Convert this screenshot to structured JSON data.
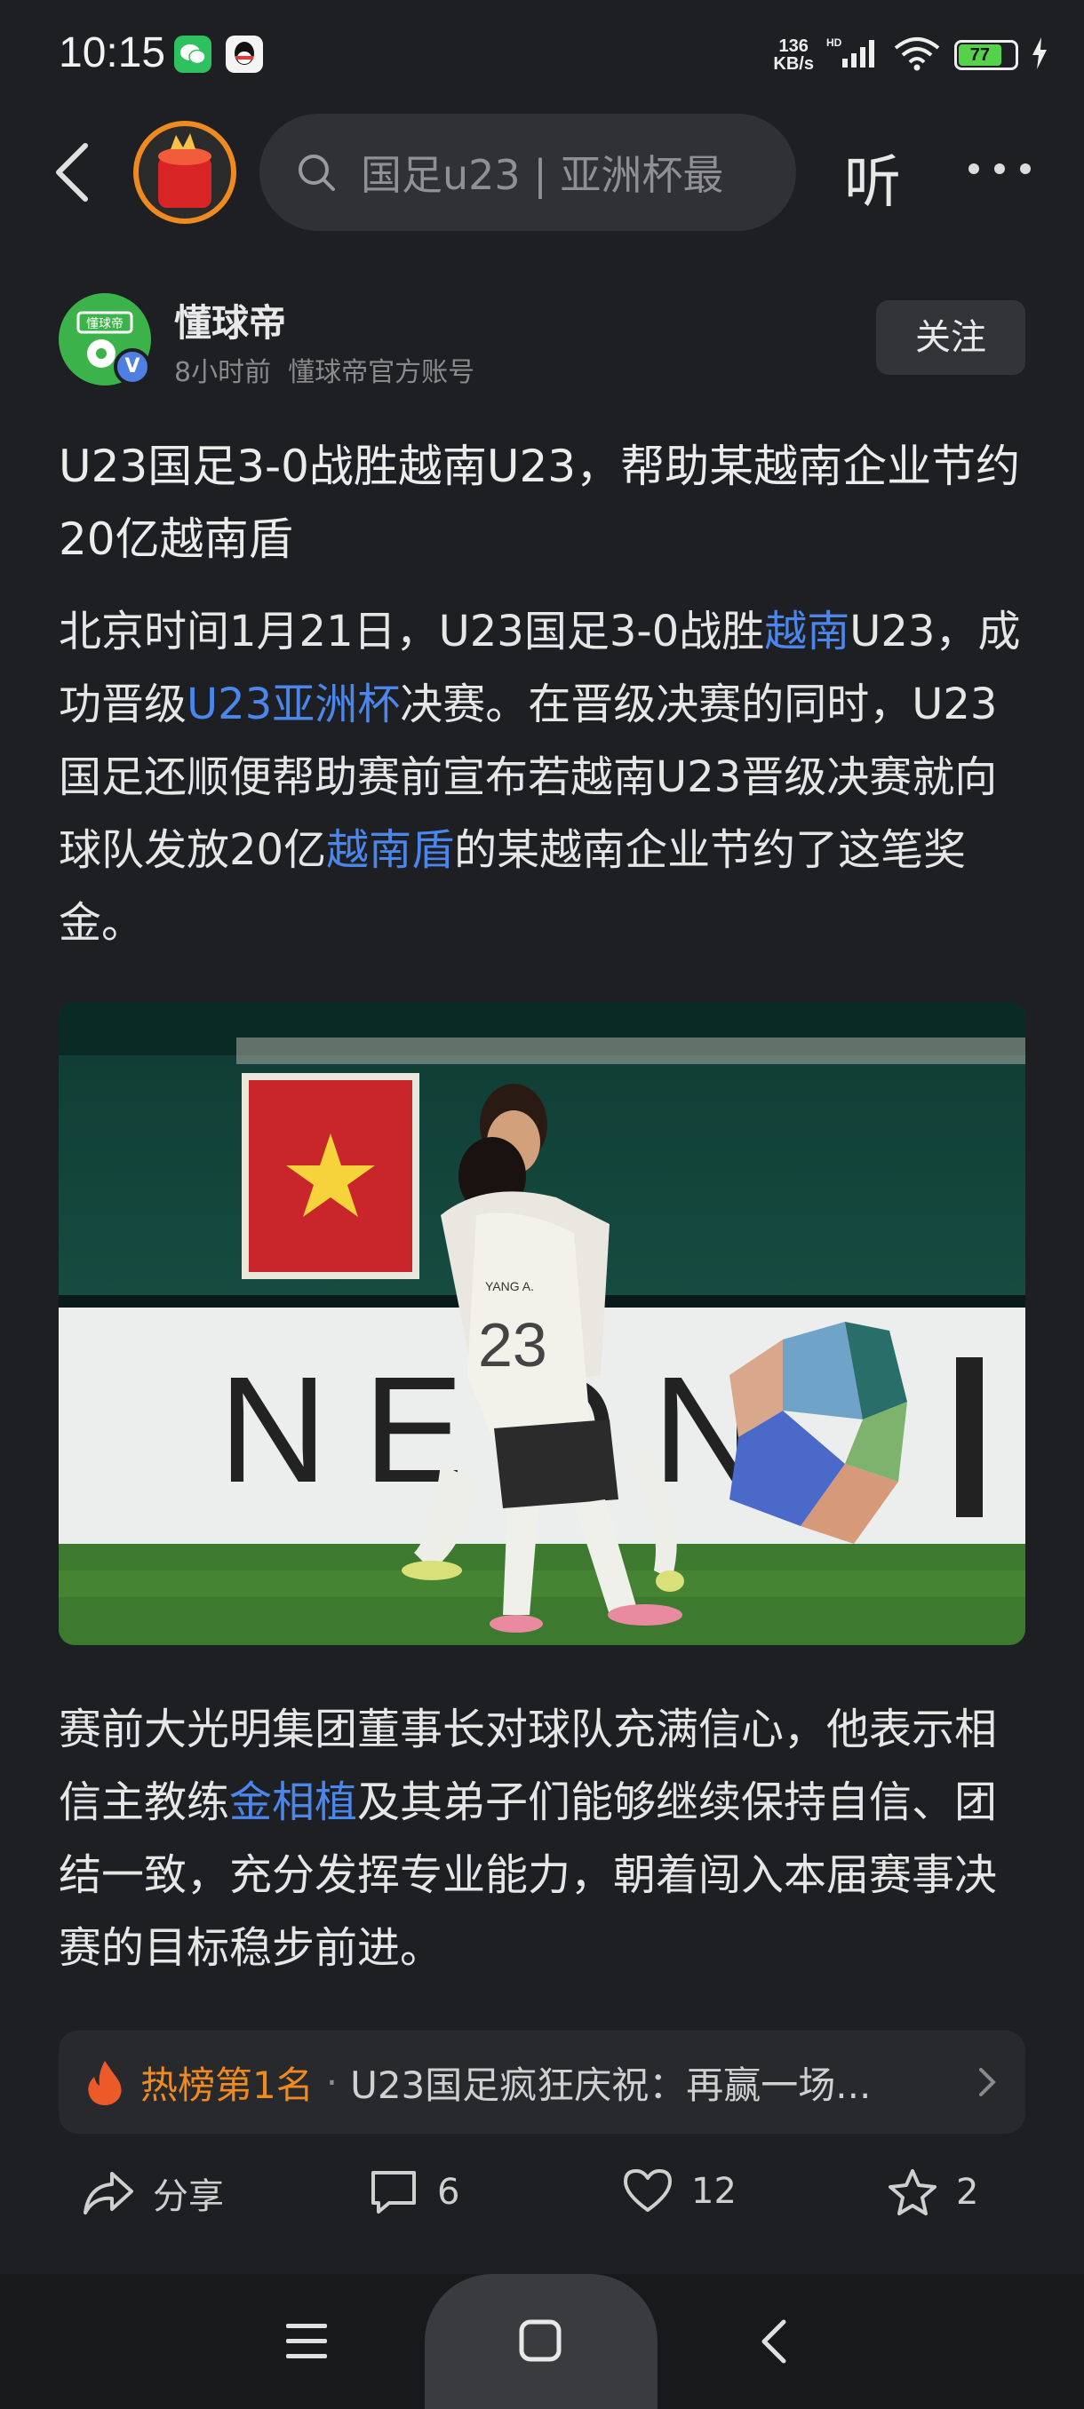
{
  "status_bar": {
    "time": "10:15",
    "net_speed_value": "136",
    "net_speed_unit": "KB/s",
    "battery": "77",
    "hd": "HD"
  },
  "nav": {
    "search_placeholder": "国足u23 | 亚洲杯最",
    "listen_label": "听"
  },
  "author": {
    "name": "懂球帝",
    "time": "8小时前",
    "account": "懂球帝官方账号",
    "avatar_text": "懂球帝",
    "badge": "V",
    "follow_label": "关注"
  },
  "post": {
    "title": "U23国足3-0战胜越南U23，帮助某越南企业节约20亿越南盾",
    "p1_a": "北京时间1月21日，U23国足3-0战胜",
    "p1_link1": "越南",
    "p1_b": "U23，成功晋级",
    "p1_link2": "U23亚洲杯",
    "p1_c": "决赛。在晋级决赛的同时，U23国足还顺便帮助赛前宣布若越南U23晋级决赛就向球队发放20亿",
    "p1_link3": "越南盾",
    "p1_d": "的某越南企业节约了这笔奖金。",
    "p2_a": "赛前大光明集团董事长对球队充满信心，他表示相信主教练",
    "p2_link": "金相植",
    "p2_b": "及其弟子们能够继续保持自信、团结一致，充分发挥专业能力，朝着闯入本届赛事决赛的目标稳步前进。",
    "photo_board_text": "NEON",
    "photo_jersey_name": "YANG A.",
    "photo_jersey_number": "23"
  },
  "hot": {
    "rank": "热榜第1名",
    "dot": "·",
    "text": "U23国足疯狂庆祝：再赢一场..."
  },
  "actions": {
    "share": "分享",
    "comments": "6",
    "likes": "12",
    "favorites": "2"
  },
  "colors": {
    "background": "#1e1f22",
    "link": "#4a86ec",
    "accent_orange": "#ef8a21"
  }
}
